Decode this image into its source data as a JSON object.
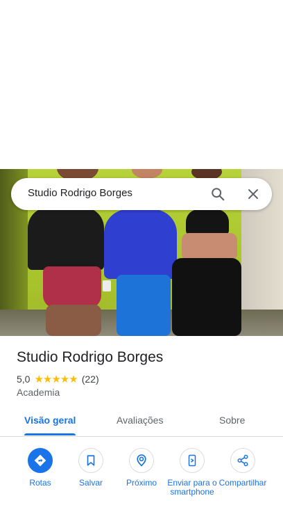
{
  "search": {
    "query": "Studio Rodrigo Borges"
  },
  "place": {
    "title": "Studio Rodrigo Borges",
    "rating": "5,0",
    "stars": "★★★★★",
    "review_count": "(22)",
    "category": "Academia"
  },
  "tabs": [
    {
      "label": "Visão geral",
      "active": true
    },
    {
      "label": "Avaliações",
      "active": false
    },
    {
      "label": "Sobre",
      "active": false
    }
  ],
  "actions": [
    {
      "label": "Rotas",
      "icon": "directions-icon"
    },
    {
      "label": "Salvar",
      "icon": "bookmark-icon"
    },
    {
      "label": "Próximo",
      "icon": "nearby-icon"
    },
    {
      "label": "Enviar para o smartphone",
      "icon": "send-to-phone-icon"
    },
    {
      "label": "Compartilhar",
      "icon": "share-icon"
    }
  ],
  "colors": {
    "accent": "#1a73e8",
    "star": "#fbbc04"
  }
}
